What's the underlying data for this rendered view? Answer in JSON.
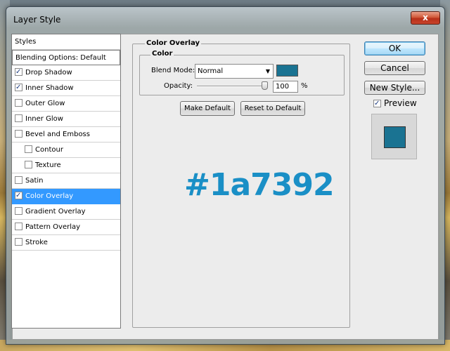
{
  "window": {
    "title": "Layer Style",
    "close_glyph": "x"
  },
  "styles": {
    "header": "Styles",
    "blending": "Blending Options: Default",
    "items": [
      {
        "label": "Drop Shadow",
        "checked": true
      },
      {
        "label": "Inner Shadow",
        "checked": true
      },
      {
        "label": "Outer Glow",
        "checked": false
      },
      {
        "label": "Inner Glow",
        "checked": false
      },
      {
        "label": "Bevel and Emboss",
        "checked": false
      },
      {
        "label": "Contour",
        "checked": false
      },
      {
        "label": "Texture",
        "checked": false
      },
      {
        "label": "Satin",
        "checked": false
      },
      {
        "label": "Color Overlay",
        "checked": true
      },
      {
        "label": "Gradient Overlay",
        "checked": false
      },
      {
        "label": "Pattern Overlay",
        "checked": false
      },
      {
        "label": "Stroke",
        "checked": false
      }
    ]
  },
  "panel": {
    "title": "Color Overlay",
    "color_group": "Color",
    "blend_mode_label": "Blend Mode:",
    "blend_mode_value": "Normal",
    "opacity_label": "Opacity:",
    "opacity_value": "100",
    "opacity_unit": "%",
    "make_default": "Make Default",
    "reset_default": "Reset to Default",
    "hex_label": "#1a7392"
  },
  "buttons": {
    "ok": "OK",
    "cancel": "Cancel",
    "new_style": "New Style...",
    "preview_label": "Preview",
    "preview_checked": true
  },
  "colors": {
    "overlay": "#1a7392",
    "accent": "#3399ff",
    "hex_text": "#1a8fc6"
  },
  "icons": {
    "check": "✓",
    "dropdown": "▼"
  }
}
